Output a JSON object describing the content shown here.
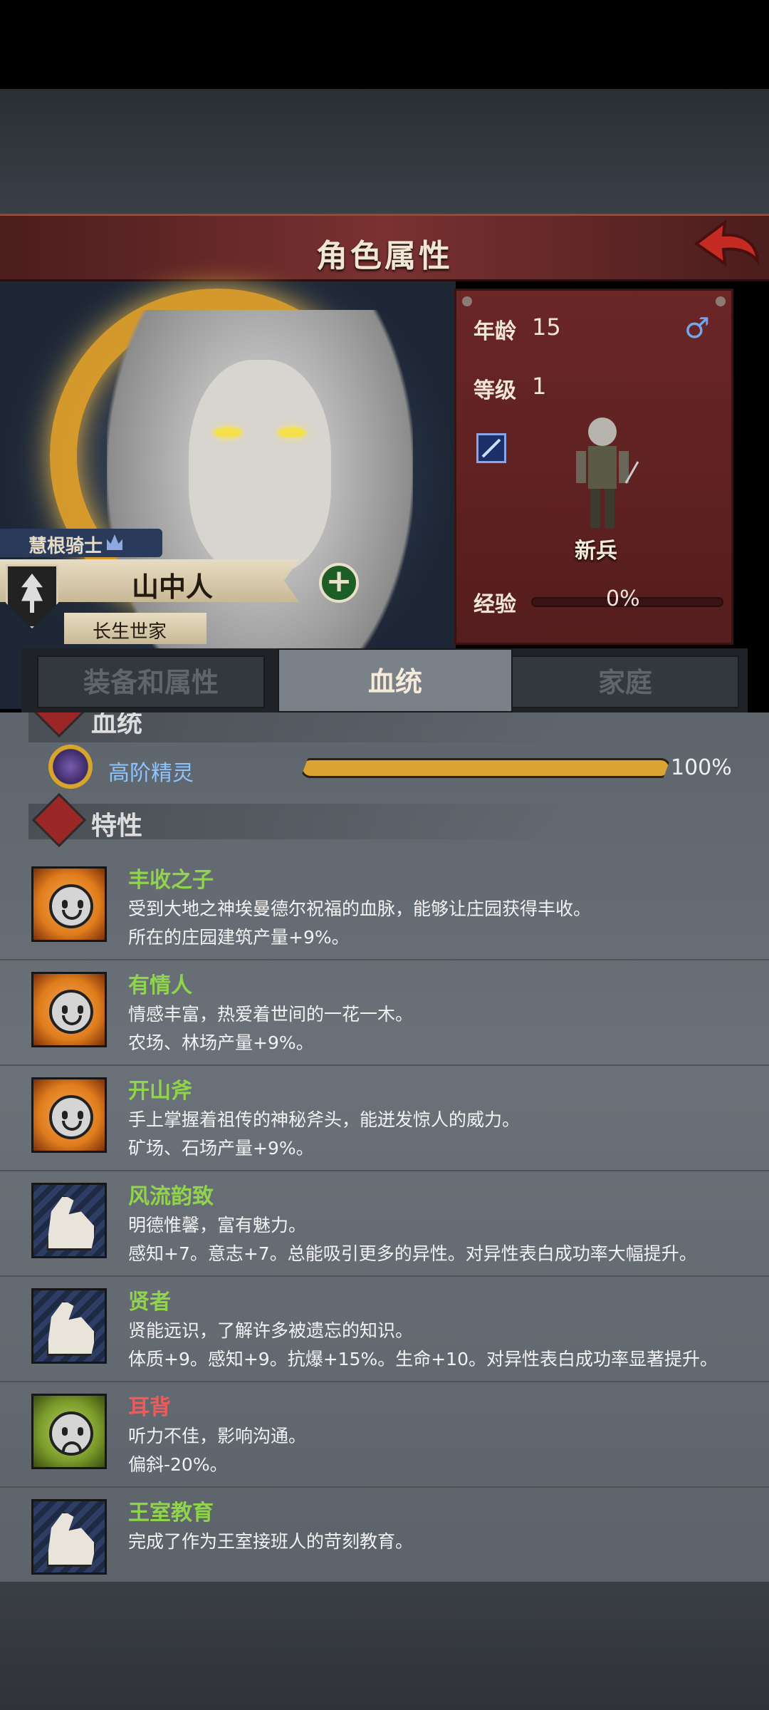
{
  "header": {
    "title": "角色属性"
  },
  "stats": {
    "age_label": "年龄",
    "age_value": "15",
    "level_label": "等级",
    "level_value": "1",
    "rank": "新兵",
    "exp_label": "经验",
    "exp_value": "0%"
  },
  "character": {
    "title_tag": "慧根骑士",
    "name": "山中人",
    "family": "长生世家"
  },
  "tabs": [
    "装备和属性",
    "血统",
    "家庭"
  ],
  "active_tab": "血统",
  "bloodline": {
    "section_title": "血统",
    "name": "高阶精灵",
    "percent": "100%",
    "fill_fraction": 1.0
  },
  "traits_section": {
    "title": "特性"
  },
  "traits": [
    {
      "name": "丰收之子",
      "type": "good",
      "icon": "smiley-icon",
      "line1": "受到大地之神埃曼德尔祝福的血脉，能够让庄园获得丰收。",
      "line2": "所在的庄园建筑产量+9%。"
    },
    {
      "name": "有情人",
      "type": "good",
      "icon": "smiley-icon",
      "line1": "情感丰富，热爱着世间的一花一木。",
      "line2": "农场、林场产量+9%。"
    },
    {
      "name": "开山斧",
      "type": "good",
      "icon": "smiley-icon",
      "line1": "手上掌握着祖传的神秘斧头，能迸发惊人的威力。",
      "line2": "矿场、石场产量+9%。"
    },
    {
      "name": "风流韵致",
      "type": "good",
      "icon": "muscle-icon",
      "line1": "明德惟馨，富有魅力。",
      "line2": "感知+7。意志+7。总能吸引更多的异性。对异性表白成功率大幅提升。"
    },
    {
      "name": "贤者",
      "type": "good",
      "icon": "muscle-icon",
      "line1": "贤能远识，了解许多被遗忘的知识。",
      "line2": "体质+9。感知+9。抗爆+15%。生命+10。对异性表白成功率显著提升。"
    },
    {
      "name": "耳背",
      "type": "bad",
      "icon": "frown-icon",
      "line1": "听力不佳，影响沟通。",
      "line2": "偏斜-20%。"
    },
    {
      "name": "王室教育",
      "type": "good",
      "icon": "muscle-icon",
      "line1": "完成了作为王室接班人的苛刻教育。",
      "line2": ""
    }
  ]
}
